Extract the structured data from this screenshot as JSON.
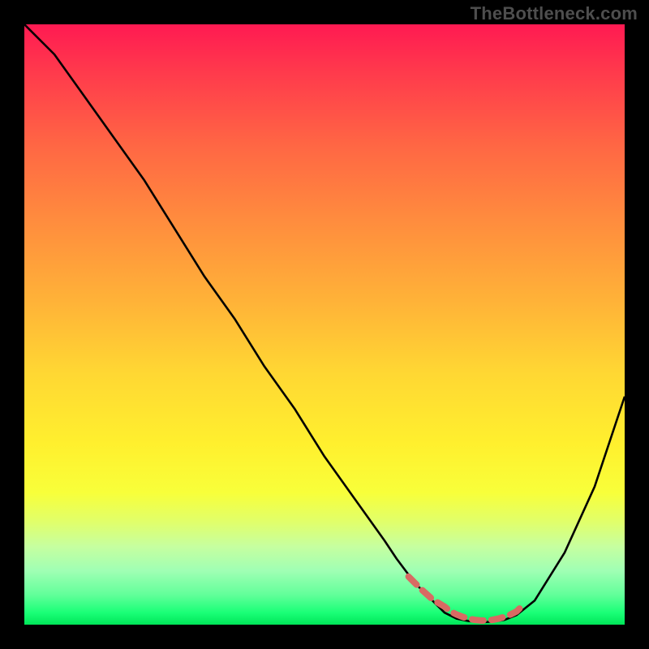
{
  "watermark": "TheBottleneck.com",
  "chart_data": {
    "type": "line",
    "title": "",
    "xlabel": "",
    "ylabel": "",
    "xlim": [
      0,
      100
    ],
    "ylim": [
      0,
      100
    ],
    "series": [
      {
        "name": "curve",
        "x": [
          0,
          5,
          10,
          15,
          20,
          25,
          30,
          35,
          40,
          45,
          50,
          55,
          60,
          62,
          65,
          68,
          70,
          72,
          74,
          76,
          78,
          80,
          82,
          85,
          90,
          95,
          100
        ],
        "values": [
          100,
          95,
          88,
          81,
          74,
          66,
          58,
          51,
          43,
          36,
          28,
          21,
          14,
          11,
          7,
          4,
          2,
          1,
          0.6,
          0.4,
          0.5,
          0.8,
          1.6,
          4,
          12,
          23,
          38
        ]
      }
    ],
    "highlight": {
      "name": "highlight-band",
      "color": "#d86a63",
      "x": [
        64,
        66,
        68,
        70,
        71,
        72,
        73,
        74,
        75,
        76,
        77,
        78,
        79,
        80,
        81,
        82,
        83
      ],
      "values": [
        8,
        6,
        4.2,
        3,
        2.2,
        1.7,
        1.3,
        1,
        0.8,
        0.7,
        0.7,
        0.8,
        1,
        1.3,
        1.7,
        2.2,
        3.2
      ]
    }
  }
}
